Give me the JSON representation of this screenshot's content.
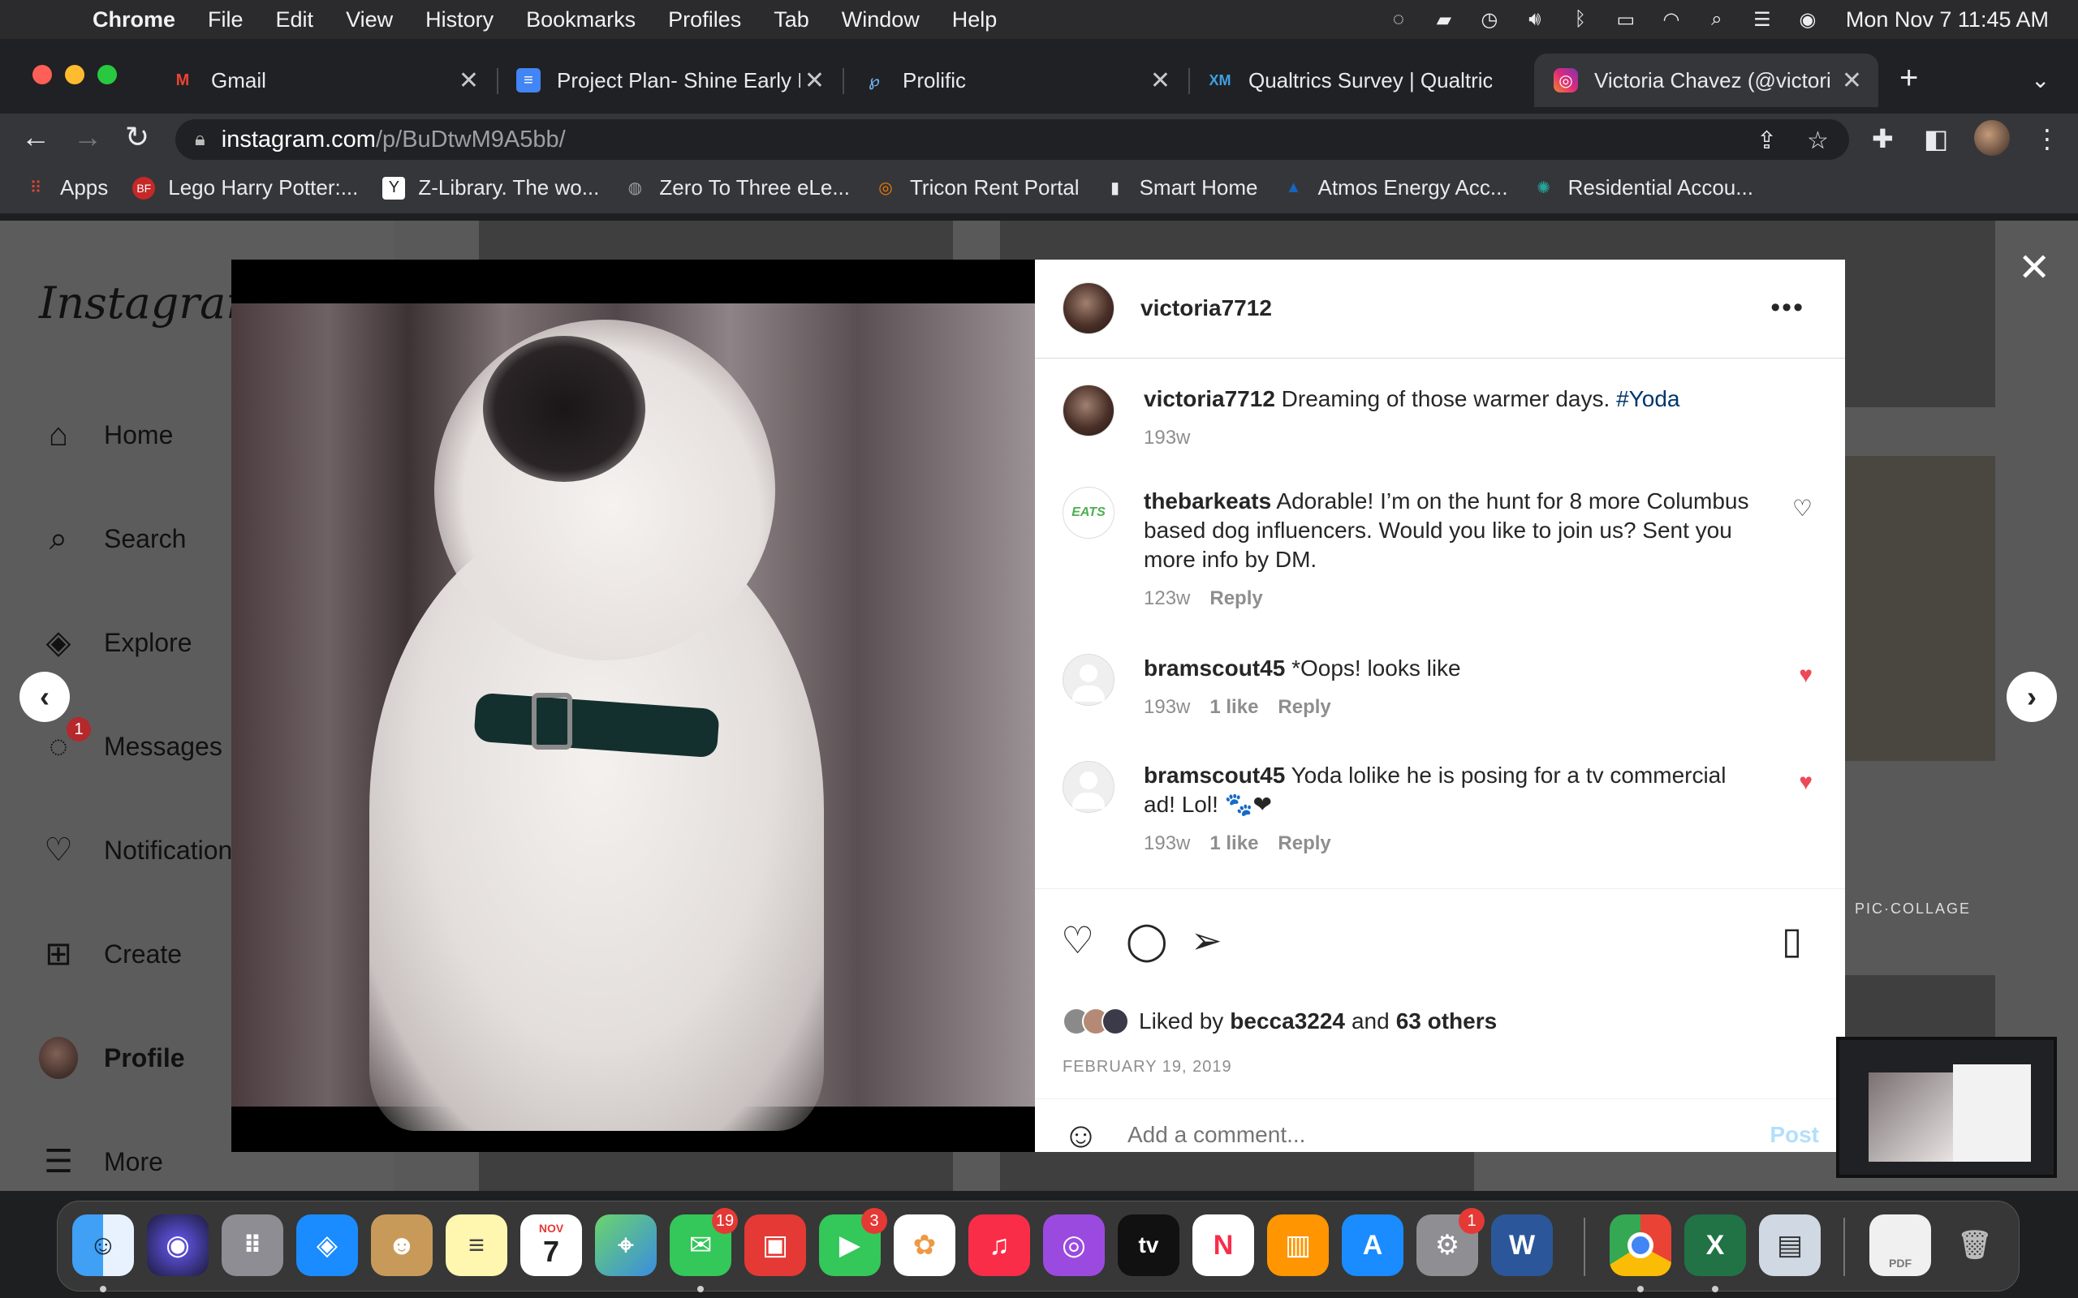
{
  "menubar": {
    "app": "Chrome",
    "items": [
      "File",
      "Edit",
      "View",
      "History",
      "Bookmarks",
      "Profiles",
      "Tab",
      "Window",
      "Help"
    ],
    "clock": "Mon Nov 7  11:45 AM"
  },
  "tabs": [
    {
      "title": "Gmail",
      "icon": "gmail-icon",
      "color": "#ea4335"
    },
    {
      "title": "Project Plan- Shine Early L",
      "icon": "docs-icon",
      "color": "#4285f4"
    },
    {
      "title": "Prolific",
      "icon": "prolific-icon",
      "color": "#4a90d9"
    },
    {
      "title": "Qualtrics Survey | Qualtric",
      "icon": "qualtrics-icon",
      "color": "#3ea0e0"
    },
    {
      "title": "Victoria Chavez (@victoria",
      "icon": "instagram-icon",
      "color": "#e1306c"
    }
  ],
  "omnibox": {
    "host": "instagram.com",
    "path": "/p/BuDtwM9A5bb/"
  },
  "bookmarks": [
    {
      "label": "Apps",
      "icon": "apps-grid-icon",
      "color": "#ea4335"
    },
    {
      "label": "Lego Harry Potter:...",
      "icon": "bf-icon",
      "color": "#c62828"
    },
    {
      "label": "Z-Library. The wo...",
      "icon": "zlibrary-icon",
      "color": "#ffffff"
    },
    {
      "label": "Zero To Three eLe...",
      "icon": "globe-icon",
      "color": "#9e9e9e"
    },
    {
      "label": "Tricon Rent Portal",
      "icon": "tricon-icon",
      "color": "#f57c00"
    },
    {
      "label": "Smart Home",
      "icon": "bars-icon",
      "color": "#ffffff"
    },
    {
      "label": "Atmos Energy Acc...",
      "icon": "atmos-icon",
      "color": "#1565c0"
    },
    {
      "label": "Residential Accou...",
      "icon": "spark-icon",
      "color": "#26a69a"
    }
  ],
  "instagram": {
    "logo": "Instagram",
    "nav": [
      {
        "label": "Home",
        "icon": "home-icon"
      },
      {
        "label": "Search",
        "icon": "search-icon"
      },
      {
        "label": "Explore",
        "icon": "compass-icon"
      },
      {
        "label": "Messages",
        "icon": "messenger-icon",
        "badge": "1"
      },
      {
        "label": "Notification",
        "icon": "heart-icon"
      },
      {
        "label": "Create",
        "icon": "plus-square-icon"
      },
      {
        "label": "Profile",
        "icon": "profile-avatar-icon"
      },
      {
        "label": "More",
        "icon": "hamburger-icon"
      }
    ]
  },
  "post": {
    "author": "victoria7712",
    "caption_user": "victoria7712",
    "caption_text": "Dreaming of those warmer days.",
    "caption_tag": "#Yoda",
    "caption_age": "193w",
    "comments": [
      {
        "user": "thebarkeats",
        "text": "Adorable! I’m on the hunt for 8 more Columbus based dog influencers. Would you like to join us? Sent you more info by DM.",
        "age": "123w",
        "likes": "",
        "reply": "Reply",
        "liked": false,
        "avatar_text": "EATS"
      },
      {
        "user": "bramscout45",
        "text": "*Oops! looks like",
        "age": "193w",
        "likes": "1 like",
        "reply": "Reply",
        "liked": true
      },
      {
        "user": "bramscout45",
        "text": "Yoda lolike he is posing for a tv commercial ad! Lol! 🐾❤",
        "age": "193w",
        "likes": "1 like",
        "reply": "Reply",
        "liked": true
      }
    ],
    "liked_prefix": "Liked by",
    "liked_user": "becca3224",
    "liked_and": "and",
    "liked_others": "63 others",
    "date": "FEBRUARY 19, 2019",
    "comment_placeholder": "Add a comment...",
    "post_label": "Post",
    "like_color": "#ed4956"
  },
  "dock": {
    "calendar_month": "NOV",
    "calendar_day": "7",
    "messages_badge": "19",
    "facetime_badge": "3",
    "settings_badge": "1",
    "tv_label": "tv",
    "pdf_label": "PDF"
  },
  "thumbnail": {
    "label": "PIC·COLLAGE"
  }
}
